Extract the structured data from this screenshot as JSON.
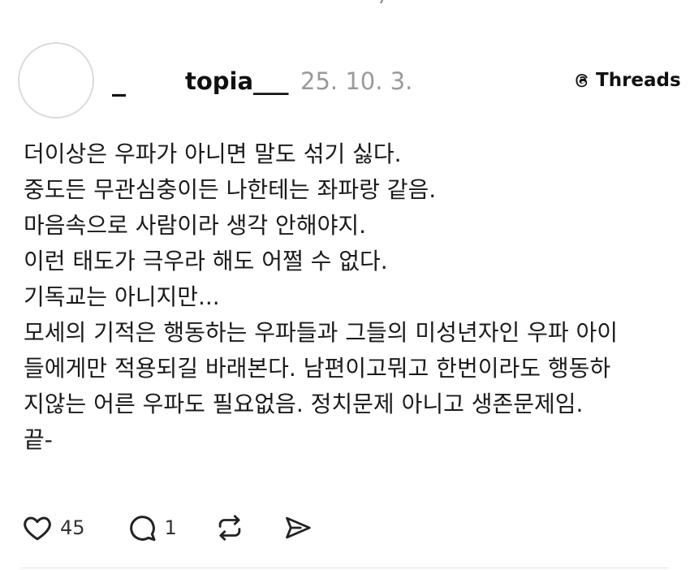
{
  "post": {
    "display_name": "_",
    "username": "topia___",
    "date": "25. 10. 3.",
    "source": {
      "label": "Threads",
      "icon": "threads-logo-icon"
    },
    "lines": [
      "더이상은 우파가 아니면 말도 섞기 싫다.",
      "중도든 무관심충이든 나한테는 좌파랑 같음.",
      "마음속으로 사람이라 생각 안해야지.",
      "이런 태도가 극우라 해도 어쩔 수 없다.",
      "기독교는 아니지만...",
      "모세의 기적은 행동하는 우파들과 그들의 미성년자인 우파 아이",
      "들에게만 적용되길 바래본다. 남편이고뭐고 한번이라도 행동하",
      "지않는 어른 우파도 필요없음. 정치문제 아니고 생존문제임.",
      "끝-"
    ],
    "actions": {
      "like": {
        "icon": "heart-icon",
        "count": "45"
      },
      "reply": {
        "icon": "comment-icon",
        "count": "1"
      },
      "repost": {
        "icon": "repost-icon"
      },
      "share": {
        "icon": "send-icon"
      }
    }
  },
  "colors": {
    "text": "#111111",
    "muted": "#9a9a9a",
    "divider": "#e3e3e3",
    "avatar_border": "#d9dbde"
  }
}
